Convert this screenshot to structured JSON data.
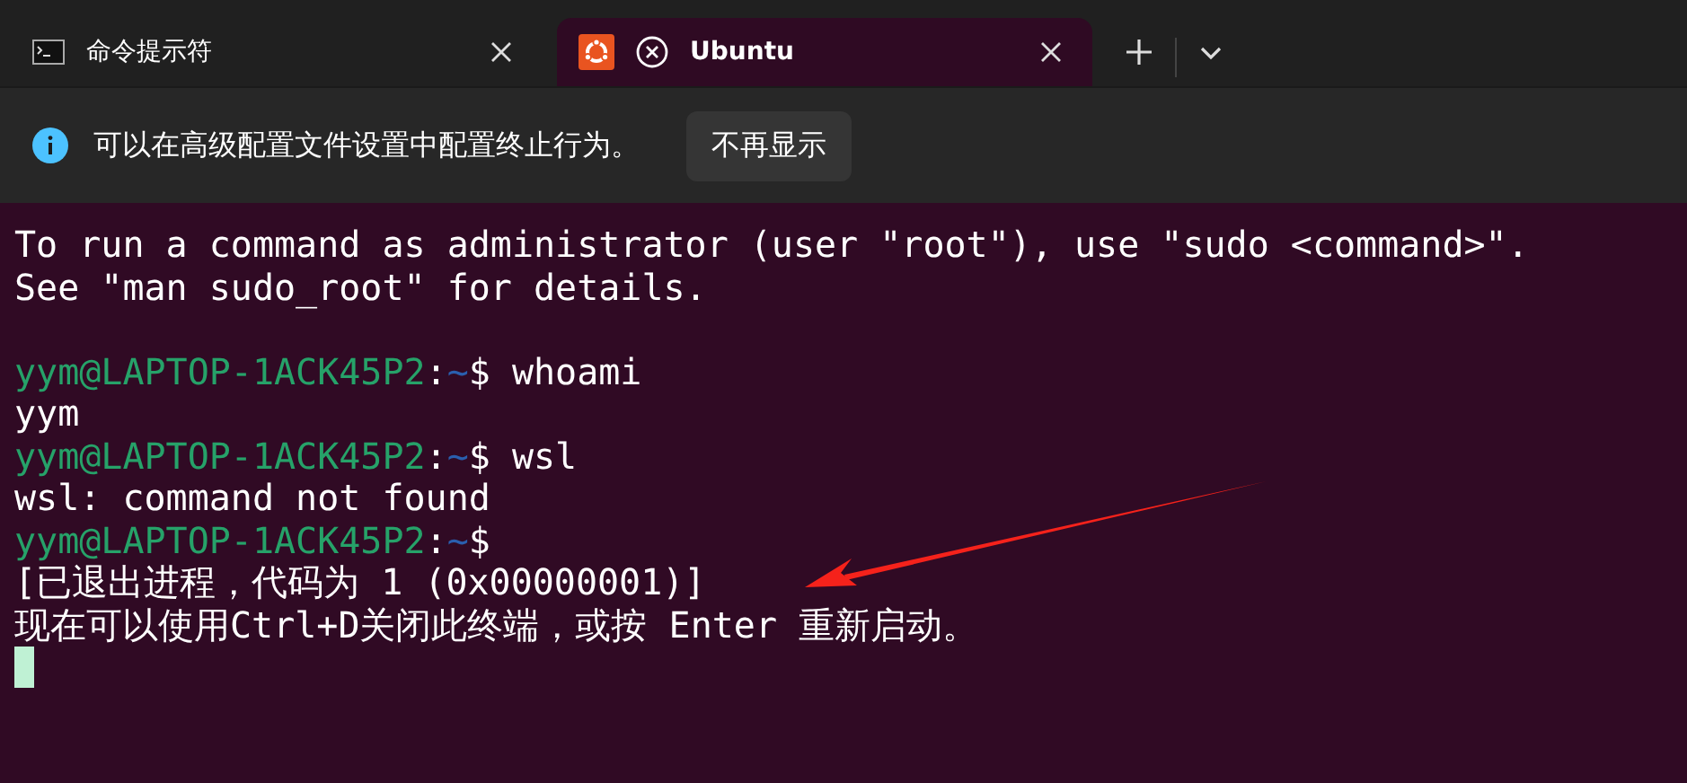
{
  "tabs": [
    {
      "title": "命令提示符",
      "kind": "cmd",
      "selected": false,
      "exited": false
    },
    {
      "title": "Ubuntu",
      "kind": "ubuntu",
      "selected": true,
      "exited": true
    }
  ],
  "info_bar": {
    "message": "可以在高级配置文件设置中配置终止行为。",
    "button": "不再显示"
  },
  "terminal": {
    "lines": [
      {
        "kind": "text",
        "text": "To run a command as administrator (user \"root\"), use \"sudo <command>\"."
      },
      {
        "kind": "text",
        "text": "See \"man sudo_root\" for details."
      },
      {
        "kind": "blank"
      },
      {
        "kind": "prompt",
        "user_host": "yym@LAPTOP-1ACK45P2",
        "separator": ":",
        "path": "~",
        "symbol": "$",
        "command": "whoami"
      },
      {
        "kind": "text",
        "text": "yym"
      },
      {
        "kind": "prompt",
        "user_host": "yym@LAPTOP-1ACK45P2",
        "separator": ":",
        "path": "~",
        "symbol": "$",
        "command": "wsl"
      },
      {
        "kind": "text",
        "text": "wsl: command not found"
      },
      {
        "kind": "prompt",
        "user_host": "yym@LAPTOP-1ACK45P2",
        "separator": ":",
        "path": "~",
        "symbol": "$"
      },
      {
        "kind": "text",
        "text": "[已退出进程，代码为 1 (0x00000001)]"
      },
      {
        "kind": "text",
        "text": "现在可以使用Ctrl+D关闭此终端，或按 Enter 重新启动。"
      },
      {
        "kind": "cursor"
      }
    ]
  }
}
